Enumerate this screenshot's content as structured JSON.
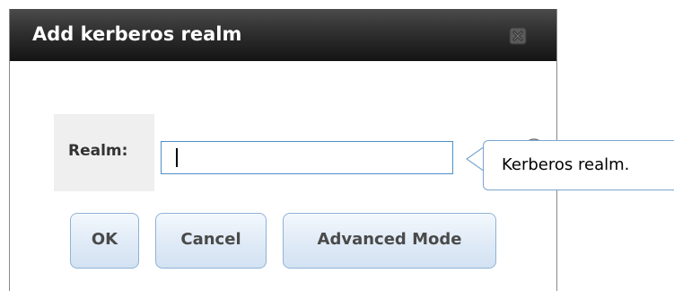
{
  "dialog": {
    "title": "Add kerberos realm"
  },
  "form": {
    "realm_label": "Realm:",
    "realm_value": "",
    "realm_tooltip": "Kerberos realm."
  },
  "buttons": {
    "ok_label": "OK",
    "cancel_label": "Cancel",
    "advanced_label": "Advanced Mode"
  },
  "icons": {
    "close": "close-icon",
    "info": "info-icon"
  },
  "colors": {
    "titlebar": "#2f2f2f",
    "button_border": "#8fb2d6",
    "input_border": "#4d90c9",
    "tooltip_border": "#7aa6cf"
  }
}
